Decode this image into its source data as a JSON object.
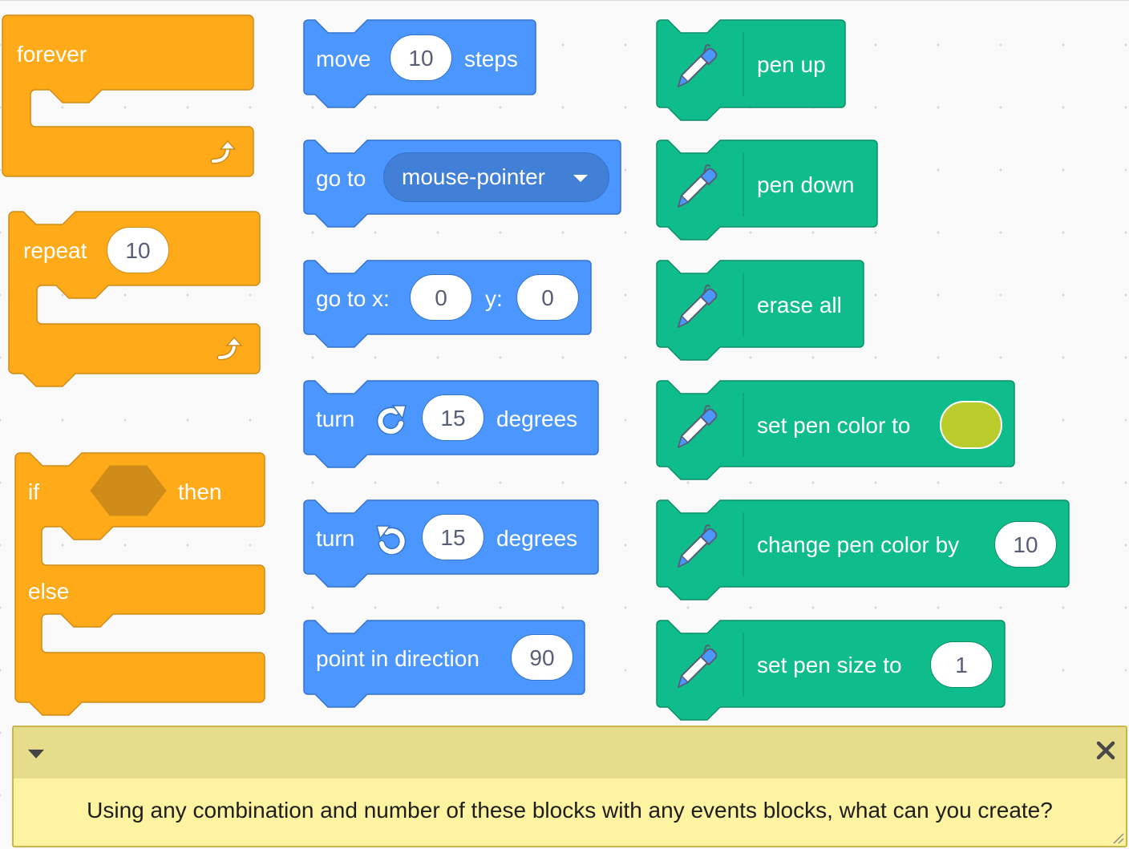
{
  "colors": {
    "control": "#ffab19",
    "control_dark": "#cf8b17",
    "motion": "#4c97ff",
    "motion_dark": "#3373cc",
    "pen": "#0fbd8c",
    "pen_dark": "#0b8e69",
    "pen_color_swatch": "#b9cc2c",
    "panel_bg": "#fdf3a0"
  },
  "control": {
    "forever": {
      "label": "forever",
      "icon": "loop-arrow-icon"
    },
    "repeat": {
      "label": "repeat",
      "times": "10",
      "icon": "loop-arrow-icon"
    },
    "if_else": {
      "if_label": "if",
      "then_label": "then",
      "else_label": "else",
      "condition_icon": "hexagon-slot-icon"
    }
  },
  "motion": {
    "move": {
      "label": "move",
      "steps": "10",
      "suffix": "steps"
    },
    "goto": {
      "label": "go to",
      "target": "mouse-pointer"
    },
    "gotoxy": {
      "label": "go to x:",
      "x": "0",
      "y_label": "y:",
      "y": "0"
    },
    "turn_right": {
      "label": "turn",
      "icon": "rotate-clockwise-icon",
      "degrees": "15",
      "suffix": "degrees"
    },
    "turn_left": {
      "label": "turn",
      "icon": "rotate-counterclockwise-icon",
      "degrees": "15",
      "suffix": "degrees"
    },
    "point": {
      "label": "point in direction",
      "direction": "90"
    }
  },
  "pen": {
    "icon": "pen-icon",
    "pen_up": {
      "label": "pen up"
    },
    "pen_down": {
      "label": "pen down"
    },
    "erase_all": {
      "label": "erase all"
    },
    "set_color": {
      "label": "set pen color to"
    },
    "change_color": {
      "label": "change pen color by",
      "value": "10"
    },
    "set_size": {
      "label": "set pen size to",
      "value": "1"
    }
  },
  "help_panel": {
    "text": "Using any combination and number of these blocks with any events blocks, what can you create?",
    "collapse_icon": "collapse-triangle-icon",
    "close_icon": "close-icon"
  }
}
